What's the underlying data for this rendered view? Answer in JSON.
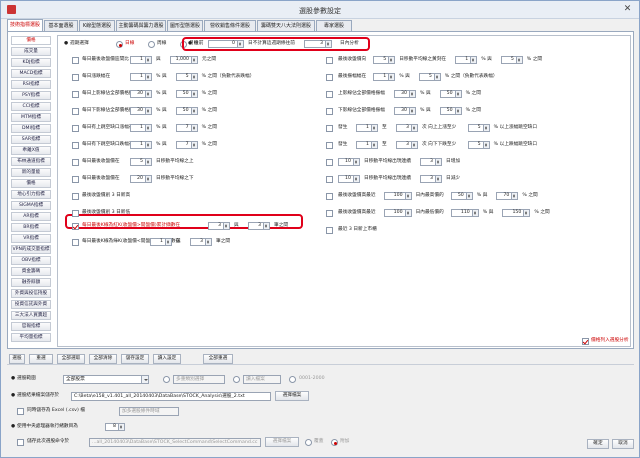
{
  "window": {
    "title": "選股參數設定"
  },
  "tabs": [
    "技術指標選股",
    "基本面選股",
    "K線型態選股",
    "主動籌碼與籌力選股",
    "圖形型態選股",
    "營收銷售條件選股",
    "籌碼雙天八大法則選股",
    "專家選股"
  ],
  "sidebar": [
    "價格",
    "成交量",
    "KDJ指標",
    "MACD指標",
    "RSI指標",
    "PSY指標",
    "CCI指標",
    "MTM指標",
    "DMI指標",
    "SAR指標",
    "乖離X值",
    "布林通道指標",
    "新的量能",
    "價格",
    "地心引力指標",
    "SIGMA指標",
    "AR指標",
    "BR指標",
    "VR指標",
    "VPN的成交量指標",
    "OBV指標",
    "資金籌碼",
    "融券餘額",
    "外資與投信持股",
    "投資信託與外資",
    "三大法人買賣超",
    "官報指標",
    "平均量指標"
  ],
  "period": {
    "label": "週期選擇",
    "options": [
      "日線",
      "周線",
      "月線"
    ],
    "selected": "日線",
    "recent_label": "往前",
    "recent_value": "0",
    "exclude_label": "日不計算這週期條往前",
    "exclude_value": "3",
    "exclude_suffix": "日內分析"
  },
  "left_rows": [
    {
      "checked": false,
      "highlight": false,
      "label": "每日最後收盤價區間比",
      "fields": [
        {
          "v": "1"
        },
        {
          "t": "與"
        },
        {
          "v": "1,000"
        },
        {
          "t": "元之間"
        }
      ]
    },
    {
      "checked": false,
      "highlight": false,
      "label": "每日漲跌幅在",
      "fields": [
        {
          "v": "1"
        },
        {
          "t": "% 與"
        },
        {
          "v": "5"
        },
        {
          "t": "% 之間（負數代表跌幅）"
        }
      ]
    },
    {
      "checked": false,
      "highlight": false,
      "label": "每日上影線佔全部價格振幅",
      "fields": [
        {
          "v": "30"
        },
        {
          "t": "% 與"
        },
        {
          "v": "50"
        },
        {
          "t": "% 之間"
        }
      ]
    },
    {
      "checked": false,
      "highlight": false,
      "label": "每日下影線佔全部價格振幅",
      "fields": [
        {
          "v": "30"
        },
        {
          "t": "% 與"
        },
        {
          "v": "50"
        },
        {
          "t": "% 之間"
        }
      ]
    },
    {
      "checked": false,
      "highlight": false,
      "label": "每日有上跳空缺口漲幅在",
      "fields": [
        {
          "v": "1"
        },
        {
          "t": "% 與"
        },
        {
          "v": "7"
        },
        {
          "t": "% 之間"
        }
      ]
    },
    {
      "checked": false,
      "highlight": false,
      "label": "每日有下跳空缺口跌幅在",
      "fields": [
        {
          "v": "1"
        },
        {
          "t": "% 與"
        },
        {
          "v": "7"
        },
        {
          "t": "% 之間"
        }
      ]
    },
    {
      "checked": false,
      "highlight": false,
      "label": "每日最後收盤價在",
      "fields": [
        {
          "v": "5"
        },
        {
          "t": "日移動平均線之上"
        }
      ]
    },
    {
      "checked": false,
      "highlight": false,
      "label": "每日最後收盤價在",
      "fields": [
        {
          "v": "20"
        },
        {
          "t": "日移動平均線之下"
        }
      ]
    },
    {
      "checked": false,
      "highlight": false,
      "label": "最後收盤價創 3 日新高",
      "fields": []
    },
    {
      "checked": false,
      "highlight": false,
      "label": "最後收盤價創 3 日新低",
      "fields": []
    },
    {
      "checked": true,
      "highlight": true,
      "label": "每日最後K線為紅K(收盤價>開盤價)累計擷數在",
      "fields": [
        {
          "v": "3"
        },
        {
          "t": "與"
        },
        {
          "v": "3"
        },
        {
          "t": "筆之間"
        }
      ]
    },
    {
      "checked": false,
      "highlight": false,
      "label": "每日最後K線為綠K(收盤價<開盤價)累計擷數在",
      "fields": [
        {
          "v": "1"
        },
        {
          "t": "與"
        },
        {
          "v": "3"
        },
        {
          "t": "筆之間"
        }
      ]
    }
  ],
  "right_rows": [
    {
      "label": "最後收盤價向",
      "fields": [
        {
          "v": "5"
        },
        {
          "t": "日移動平均線之黃刻在"
        },
        {
          "v": "1"
        },
        {
          "t": "% 與"
        },
        {
          "v": "5"
        },
        {
          "t": "% 之間"
        }
      ]
    },
    {
      "label": "最後振幅幅在",
      "fields": [
        {
          "v": "1"
        },
        {
          "t": "% 與"
        },
        {
          "v": "5"
        },
        {
          "t": "% 之間（負數代表跌幅）"
        }
      ]
    },
    {
      "label": "上影線佔全部價格振幅",
      "fields": [
        {
          "v": "30"
        },
        {
          "t": "% 與"
        },
        {
          "v": "50"
        },
        {
          "t": "% 之間"
        }
      ]
    },
    {
      "label": "下影線佔全部價格振幅",
      "fields": [
        {
          "v": "30"
        },
        {
          "t": "% 與"
        },
        {
          "v": "50"
        },
        {
          "t": "% 之間"
        }
      ]
    },
    {
      "label": "發生",
      "fields": [
        {
          "v": "1"
        },
        {
          "t": "至"
        },
        {
          "v": "3"
        },
        {
          "t": "次 向上上漲至少"
        },
        {
          "v": "5"
        },
        {
          "t": "% 以上漲幅跳空缺口"
        }
      ]
    },
    {
      "label": "發生",
      "fields": [
        {
          "v": "1"
        },
        {
          "t": "至"
        },
        {
          "v": "3"
        },
        {
          "t": "次 向下下跌至少"
        },
        {
          "v": "5"
        },
        {
          "t": "% 以上跌幅跳空缺口"
        }
      ]
    },
    {
      "label": "",
      "fields": [
        {
          "v": "10"
        },
        {
          "t": "日移動平均線出現連續"
        },
        {
          "v": "3"
        },
        {
          "t": "日增加"
        }
      ]
    },
    {
      "label": "",
      "fields": [
        {
          "v": "10"
        },
        {
          "t": "日移動平均線出現連續"
        },
        {
          "v": "3"
        },
        {
          "t": "日減少"
        }
      ]
    },
    {
      "label": "最後收盤價高最近",
      "fields": [
        {
          "v": "100"
        },
        {
          "t": "日內最高價的"
        },
        {
          "v": "50"
        },
        {
          "t": "% 與"
        },
        {
          "v": "70"
        },
        {
          "t": "% 之間"
        }
      ]
    },
    {
      "label": "最後收盤價高最近",
      "fields": [
        {
          "v": "100"
        },
        {
          "t": "日內最低價的"
        },
        {
          "v": "110"
        },
        {
          "t": "% 與"
        },
        {
          "v": "150"
        },
        {
          "t": "% 之間"
        }
      ]
    },
    {
      "label": "最近 3 日新上市櫃",
      "fields": []
    }
  ],
  "right_option": {
    "label": "價格列入選股分析",
    "checked": true
  },
  "action_buttons": [
    "選股",
    "重選",
    "全部選取",
    "全部清除",
    "儲存設定",
    "讀入設定",
    "全部重選"
  ],
  "bottom": {
    "range_label": "選股範圍",
    "range_value": "全部股票",
    "range_opt1": "多重類別選擇",
    "range_opt2": "讀入檔案",
    "range_opt2_value": "0001-2000",
    "result_label": "選股結果檔案儲存於",
    "result_path": "C:\\Beta\\e158_v1.401_all_20140403\\DataBase\\STOCK_Analysis\\選股_2.txt",
    "result_btn": "選擇檔案",
    "export_label": "同時儲存為 Excel (.csv) 檔",
    "export_hint": "加多選股條件時域",
    "cpu_label": "使用中央處理器執行緒數目為",
    "cpu_value": "8",
    "save_label": "儲存此次選股命令於",
    "save_path": "...all_20140403\\DataBase\\STOCK_SelectCommand\\SelectCommand.cc",
    "save_btn": "選擇檔案",
    "opt_overwrite": "覆蓋",
    "opt_append": "附加",
    "ok": "確定",
    "cancel": "取消"
  }
}
